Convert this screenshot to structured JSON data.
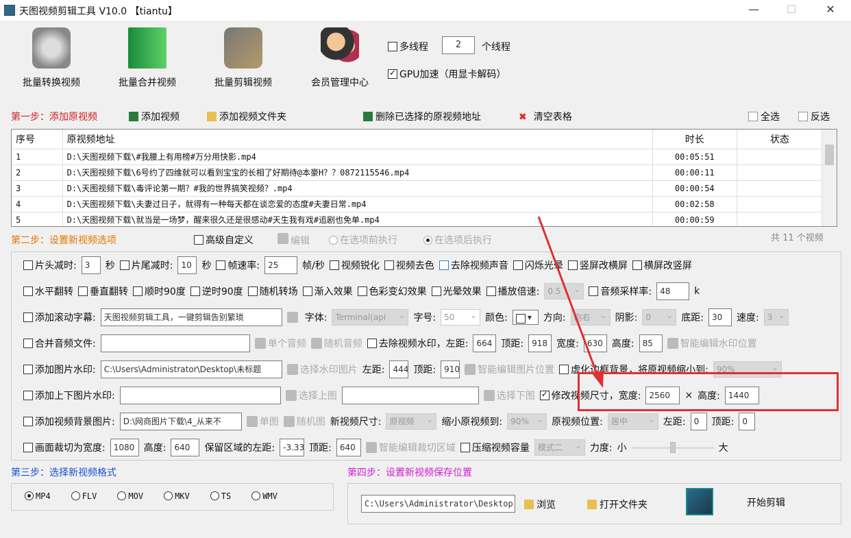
{
  "window": {
    "title": "天图视频剪辑工具 V10.0 【tiantu】",
    "minimize": "—",
    "maximize": "☐",
    "close": "✕"
  },
  "toolbar": [
    {
      "label": "批量转换视频"
    },
    {
      "label": "批量合并视频"
    },
    {
      "label": "批量剪辑视频"
    },
    {
      "label": "会员管理中心"
    }
  ],
  "threads": {
    "multithread_label": "多线程",
    "count": "2",
    "unit": "个线程",
    "gpu_label": "GPU加速（用显卡解码）"
  },
  "step1": {
    "title": "第一步：添加原视频",
    "add_video": "添加视频",
    "add_folder": "添加视频文件夹",
    "delete_selected": "删除已选择的原视频地址",
    "clear_table": "清空表格",
    "select_all": "全选",
    "invert": "反选"
  },
  "table": {
    "headers": [
      "序号",
      "原视频地址",
      "时长",
      "状态"
    ],
    "rows": [
      {
        "n": "1",
        "path": "D:\\天图视频下载\\#我腰上有用榜#万分用快影.mp4",
        "dur": "00:05:51",
        "status": ""
      },
      {
        "n": "2",
        "path": "D:\\天图视频下载\\6号约了四维就可以看到宝宝的长相了好期待@本豪H？？0872115546.mp4",
        "dur": "00:00:11",
        "status": ""
      },
      {
        "n": "3",
        "path": "D:\\天图视频下载\\毒评论第一期？#我的世界搞笑视频？.mp4",
        "dur": "00:00:54",
        "status": ""
      },
      {
        "n": "4",
        "path": "D:\\天图视频下载\\夫妻过日子，就得有一种每天都在谈恋爱的态度#夫妻日常.mp4",
        "dur": "00:02:58",
        "status": ""
      },
      {
        "n": "5",
        "path": "D:\\天图视频下载\\就当是一场梦，醒来很久还是很感动#天生我有戏#追剧也免单.mp4",
        "dur": "00:00:59",
        "status": ""
      }
    ]
  },
  "step2": {
    "title": "第二步：设置新视频选项",
    "advanced": "高级自定义",
    "edit": "编辑",
    "before": "在选项前执行",
    "after": "在选项后执行",
    "count": "共 11 个视频"
  },
  "opts": {
    "r1": [
      "片头减时:",
      "3",
      "秒",
      "片尾减时:",
      "10",
      "秒",
      "帧速率:",
      "25",
      "帧/秒",
      "视频锐化",
      "视频去色",
      "去除视频声音",
      "闪烁光晕",
      "竖屏改横屏",
      "横屏改竖屏"
    ],
    "r2": [
      "水平翻转",
      "垂直翻转",
      "顺时90度",
      "逆时90度",
      "随机转场",
      "渐入效果",
      "色彩变幻效果",
      "光晕效果",
      "播放倍速:",
      "0.5",
      "音频采样率:",
      "48",
      "k"
    ],
    "r3": [
      "添加滚动字幕:",
      "天图视频剪辑工具，一键剪辑告别繁琐",
      "字体:",
      "Terminal(api",
      "字号:",
      "50",
      "颜色:",
      "方向:",
      "向右",
      "阴影:",
      "0",
      "底距:",
      "30",
      "速度:",
      "3"
    ],
    "r4": [
      "合并音频文件:",
      "",
      "单个音频",
      "随机音频",
      "去除视频水印，左距:",
      "664",
      "顶距:",
      "918",
      "宽度:",
      "630",
      "高度:",
      "85",
      "智能编辑水印位置"
    ],
    "r5": [
      "添加图片水印:",
      "C:\\Users\\Administrator\\Desktop\\未标题",
      "选择水印图片",
      "左距:",
      "444",
      "顶距:",
      "910",
      "智能编辑图片位置",
      "虚化边框背景，将原视频缩小到:",
      "90%"
    ],
    "r6": [
      "添加上下图片水印:",
      "",
      "选择上图",
      "",
      "选择下图",
      "修改视频尺寸，宽度:",
      "2560",
      "×",
      "高度:",
      "1440"
    ],
    "r7": [
      "添加视频背景图片:",
      "D:\\网商图片下载\\4_从来不",
      "单图",
      "随机图",
      "新视频尺寸:",
      "原视频",
      "缩小原视频到:",
      "90%",
      "原视频位置:",
      "居中",
      "左距:",
      "0",
      "顶距:",
      "0"
    ],
    "r8": [
      "画面裁切为宽度:",
      "1080",
      "高度:",
      "640",
      "保留区域的左距:",
      "-3.33",
      "顶距:",
      "640",
      "智能编辑裁切区域",
      "压缩视频容量",
      "模式二",
      "力度:",
      "小",
      "大"
    ]
  },
  "slider": {
    "value": 0.5
  },
  "step3": {
    "title": "第三步：选择新视频格式",
    "formats": [
      "MP4",
      "FLV",
      "MOV",
      "MKV",
      "TS",
      "WMV"
    ],
    "selected": "MP4"
  },
  "step4": {
    "title": "第四步：设置新视频保存位置",
    "path": "C:\\Users\\Administrator\\Desktop",
    "browse": "浏览",
    "open_folder": "打开文件夹",
    "start": "开始剪辑"
  },
  "colors": {
    "step1": "#d02020",
    "step2": "#e07800",
    "step3": "#1a4fd0",
    "step4": "#d020d0",
    "highlight": "#e03030"
  }
}
